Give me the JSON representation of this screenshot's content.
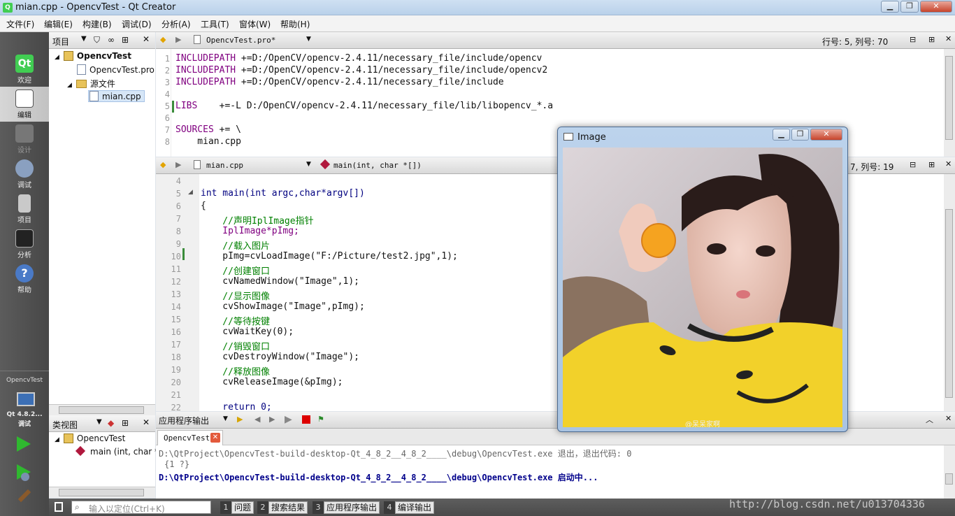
{
  "window": {
    "title": "mian.cpp - OpencvTest - Qt Creator"
  },
  "menu": [
    "文件(F)",
    "编辑(E)",
    "构建(B)",
    "调试(D)",
    "分析(A)",
    "工具(T)",
    "窗体(W)",
    "帮助(H)"
  ],
  "modes": [
    {
      "label": "欢迎"
    },
    {
      "label": "编辑"
    },
    {
      "label": "设计"
    },
    {
      "label": "调试"
    },
    {
      "label": "项目"
    },
    {
      "label": "分析"
    },
    {
      "label": "帮助"
    }
  ],
  "kit": {
    "project": "OpencvTest",
    "version": "Qt 4.8.2...",
    "mode": "调试"
  },
  "project_panel": {
    "header": "项目",
    "tree": [
      {
        "label": "OpencvTest"
      },
      {
        "label": "OpencvTest.pro"
      },
      {
        "label": "源文件"
      },
      {
        "label": "mian.cpp"
      }
    ]
  },
  "class_panel": {
    "header": "类视图",
    "tree": [
      {
        "label": "OpencvTest"
      },
      {
        "label": "main (int, char *"
      }
    ]
  },
  "editor1": {
    "file": "OpencvTest.pro*",
    "position": "行号: 5, 列号: 70",
    "lines": [
      {
        "n": "1",
        "text": "+=D:/OpenCV/opencv-2.4.11/necessary_file/include/opencv",
        "kw": "INCLUDEPATH "
      },
      {
        "n": "2",
        "text": "+=D:/OpenCV/opencv-2.4.11/necessary_file/include/opencv2",
        "kw": "INCLUDEPATH "
      },
      {
        "n": "3",
        "text": "+=D:/OpenCV/opencv-2.4.11/necessary_file/include",
        "kw": "INCLUDEPATH "
      },
      {
        "n": "4",
        "text": "",
        "kw": ""
      },
      {
        "n": "5",
        "text": "   +=-L D:/OpenCV/opencv-2.4.11/necessary_file/lib/libopencv_*.a",
        "kw": "LIBS "
      },
      {
        "n": "6",
        "text": "",
        "kw": ""
      },
      {
        "n": "7",
        "text": "+= \\",
        "kw": "SOURCES "
      },
      {
        "n": "8",
        "text": "    mian.cpp",
        "kw": ""
      }
    ]
  },
  "editor2": {
    "file": "mian.cpp",
    "function": "main(int, char *[])",
    "position": "7, 列号: 19",
    "lines": [
      {
        "n": "4",
        "text": ""
      },
      {
        "n": "5",
        "text": "int main(int argc,char*argv[])"
      },
      {
        "n": "6",
        "text": "{"
      },
      {
        "n": "7",
        "text": "    //声明IplImage指针"
      },
      {
        "n": "8",
        "text": "    IplImage*pImg;"
      },
      {
        "n": "9",
        "text": "    //载入图片"
      },
      {
        "n": "10",
        "text": "    pImg=cvLoadImage(\"F:/Picture/test2.jpg\",1);"
      },
      {
        "n": "11",
        "text": "    //创建窗口"
      },
      {
        "n": "12",
        "text": "    cvNamedWindow(\"Image\",1);"
      },
      {
        "n": "13",
        "text": "    //显示图像"
      },
      {
        "n": "14",
        "text": "    cvShowImage(\"Image\",pImg);"
      },
      {
        "n": "15",
        "text": "    //等待按键"
      },
      {
        "n": "16",
        "text": "    cvWaitKey(0);"
      },
      {
        "n": "17",
        "text": "    //销毁窗口"
      },
      {
        "n": "18",
        "text": "    cvDestroyWindow(\"Image\");"
      },
      {
        "n": "19",
        "text": "    //释放图像"
      },
      {
        "n": "20",
        "text": "    cvReleaseImage(&pImg);"
      },
      {
        "n": "21",
        "text": ""
      },
      {
        "n": "22",
        "text": "    return 0;"
      }
    ]
  },
  "output": {
    "header": "应用程序输出",
    "tab": "OpencvTest",
    "lines": [
      {
        "path": "D:\\QtProject\\OpencvTest-build-desktop-Qt_4_8_2__4_8_2____\\debug\\OpencvTest.exe",
        "msg": " 退出，退出代码: 0"
      },
      {
        "path": "{1 ?}",
        "msg": ""
      },
      {
        "path": "D:\\QtProject\\OpencvTest-build-desktop-Qt_4_8_2__4_8_2____\\debug\\OpencvTest.exe",
        "msg": " 启动中..."
      }
    ]
  },
  "image_window": {
    "title": "Image",
    "watermark": "@呆呆家啊"
  },
  "statusbar": {
    "locator_placeholder": "输入以定位(Ctrl+K)",
    "tabs": [
      {
        "num": "1",
        "label": "问题"
      },
      {
        "num": "2",
        "label": "搜索结果"
      },
      {
        "num": "3",
        "label": "应用程序输出"
      },
      {
        "num": "4",
        "label": "编译输出"
      }
    ]
  },
  "watermark": "http://blog.csdn.net/u013704336",
  "colors": {
    "qt_green": "#41cd52",
    "keyword": "#808000",
    "string": "#008000",
    "comment": "#008000",
    "type": "#800080"
  }
}
